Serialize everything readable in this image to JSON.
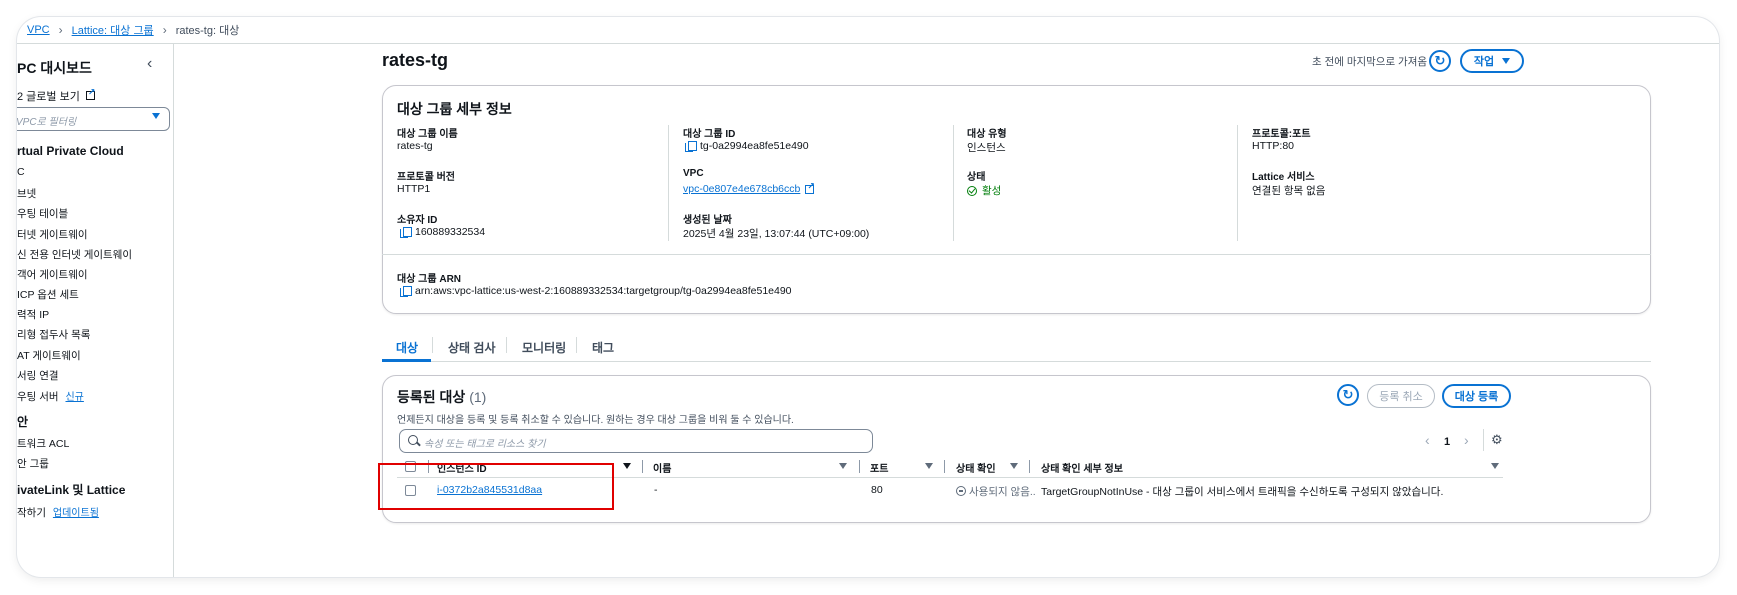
{
  "breadcrumb": {
    "items": [
      "VPC",
      "Lattice: 대상 그룹"
    ],
    "current": "rates-tg: 대상"
  },
  "sidebar": {
    "title": "PC 대시보드",
    "global_view": "2 글로벌 보기",
    "filter_placeholder": "VPC로 필터링",
    "section_vpc": "rtual Private Cloud",
    "vpc_items": [
      "C",
      "브넷",
      "우팅 테이블",
      "터넷 게이트웨이",
      "신 전용 인터넷 게이트웨이",
      "객어 게이트웨이",
      "ICP 옵션 세트",
      "력적 IP",
      "리형 접두사 목록",
      "AT 게이트웨이",
      "서링 연결",
      "우팅 서버"
    ],
    "new_badge": "신규",
    "section_security": "안",
    "security_items": [
      "트워크 ACL",
      "안 그룹"
    ],
    "section_privatelink": "ivateLink 및 Lattice",
    "privatelink_item": "작하기",
    "updated_badge": "업데이트됨"
  },
  "header": {
    "title": "rates-tg",
    "refreshed": "초 전에 마지막으로 가져옴",
    "actions_label": "작업"
  },
  "details": {
    "title": "대상 그룹 세부 정보",
    "fields": {
      "name_label": "대상 그룹 이름",
      "name_value": "rates-tg",
      "id_label": "대상 그룹 ID",
      "id_value": "tg-0a2994ea8fe51e490",
      "type_label": "대상 유형",
      "type_value": "인스턴스",
      "protocol_port_label": "프로토콜:포트",
      "protocol_port_value": "HTTP:80",
      "protocol_version_label": "프로토콜 버전",
      "protocol_version_value": "HTTP1",
      "vpc_label": "VPC",
      "vpc_value": "vpc-0e807e4e678cb6ccb",
      "status_label": "상태",
      "status_value": "활성",
      "lattice_label": "Lattice 서비스",
      "lattice_value": "연결된 항목 없음",
      "owner_label": "소유자 ID",
      "owner_value": "160889332534",
      "created_label": "생성된 날짜",
      "created_value": "2025년 4월 23일, 13:07:44 (UTC+09:00)",
      "arn_label": "대상 그룹 ARN",
      "arn_value": "arn:aws:vpc-lattice:us-west-2:160889332534:targetgroup/tg-0a2994ea8fe51e490"
    }
  },
  "tabs": [
    "대상",
    "상태 검사",
    "모니터링",
    "태그"
  ],
  "targets": {
    "title": "등록된 대상",
    "count": "(1)",
    "description": "언제든지 대상을 등록 및 등록 취소할 수 있습니다. 원하는 경우 대상 그룹을 비워 둘 수 있습니다.",
    "deregister_label": "등록 취소",
    "register_label": "대상 등록",
    "search_placeholder": "속성 또는 태그로 리소스 찾기",
    "page": "1",
    "columns": [
      "인스턴스 ID",
      "이름",
      "포트",
      "상태 확인",
      "상태 확인 세부 정보"
    ],
    "rows": [
      {
        "instance_id": "i-0372b2a845531d8aa",
        "name": "-",
        "port": "80",
        "health": "사용되지 않음..",
        "health_details": "TargetGroupNotInUse - 대상 그룹이 서비스에서 트래픽을 수신하도록 구성되지 않았습니다."
      }
    ]
  }
}
